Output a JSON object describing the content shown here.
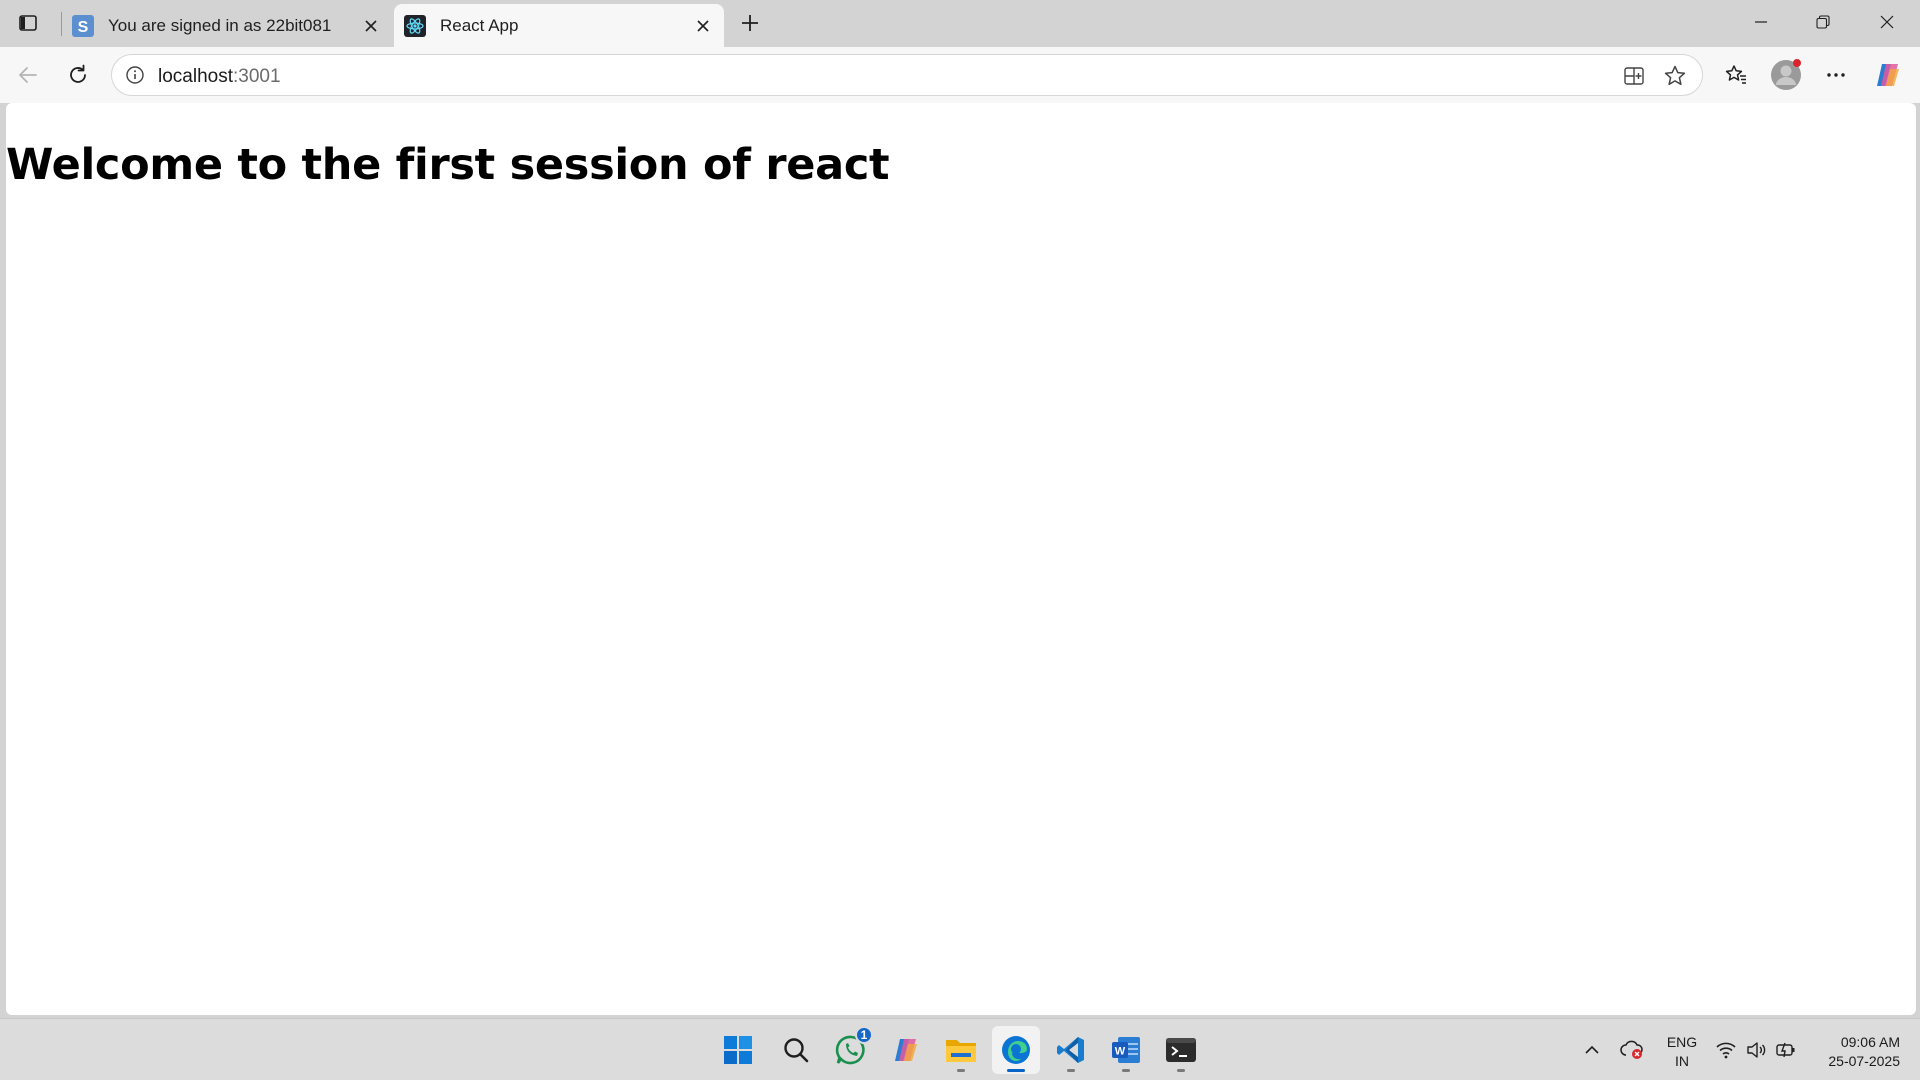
{
  "browser": {
    "tabs": [
      {
        "title": "You are signed in as 22bit081",
        "favicon": "s-letter-icon",
        "active": false
      },
      {
        "title": "React App",
        "favicon": "react-atom-icon",
        "active": true
      }
    ],
    "address": {
      "host": "localhost",
      "port": ":3001"
    }
  },
  "page": {
    "heading": "Welcome to the first session of react"
  },
  "taskbar": {
    "apps": [
      "windows-start-icon",
      "search-icon",
      "whatsapp-icon",
      "copilot-icon",
      "file-explorer-icon",
      "edge-icon",
      "vscode-icon",
      "word-icon",
      "terminal-icon"
    ],
    "whatsapp_badge": "1",
    "language": {
      "line1": "ENG",
      "line2": "IN"
    },
    "clock": {
      "time": "09:06 AM",
      "date": "25-07-2025"
    }
  },
  "colors": {
    "accent": "#0a64c8",
    "chrome_bg": "#d3d3d3",
    "toolbar_bg": "#f7f7f7"
  }
}
